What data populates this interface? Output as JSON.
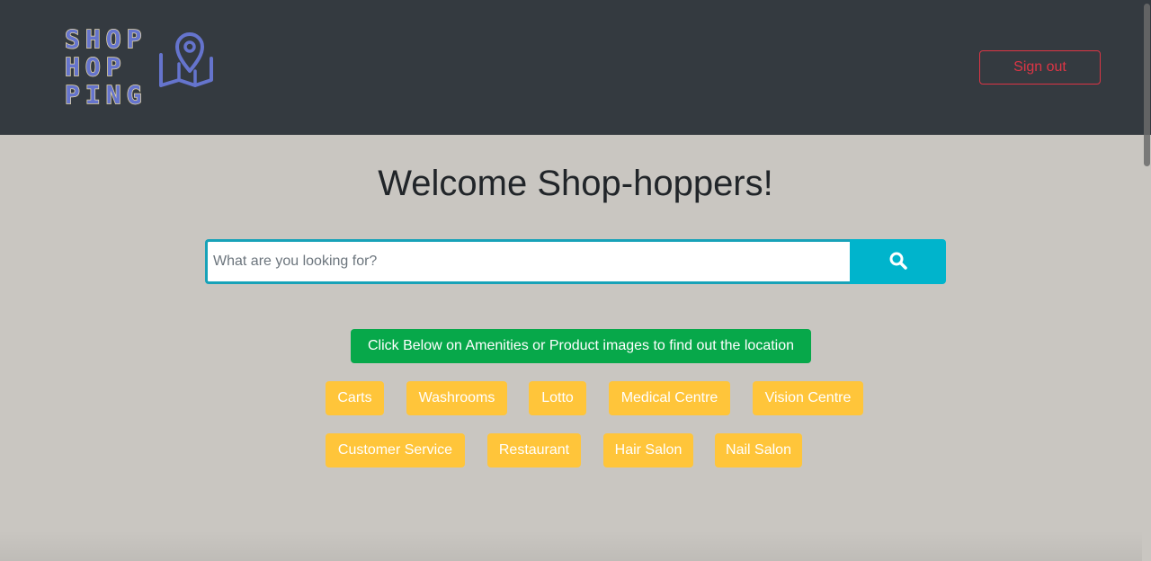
{
  "header": {
    "logo_lines": [
      "SHOP",
      "HOP",
      "PING"
    ],
    "logo_icon": "map-pin-icon",
    "signout_label": "Sign out"
  },
  "main": {
    "title": "Welcome Shop-hoppers!",
    "search": {
      "placeholder": "What are you looking for?",
      "value": "",
      "button_icon": "search-icon"
    },
    "info_label": "Click Below on Amenities or Product images to find out the location",
    "amenities": [
      "Carts",
      "Washrooms",
      "Lotto",
      "Medical Centre",
      "Vision Centre",
      "Customer Service",
      "Restaurant",
      "Hair Salon",
      "Nail Salon"
    ]
  },
  "colors": {
    "navbar": "#343a40",
    "background": "#c9c6c1",
    "logo": "#6574cd",
    "signout": "#dc3545",
    "search_border": "#17a2b8",
    "search_button": "#00b4cc",
    "info_button": "#07a84a",
    "amenity_button": "#ffc53a"
  }
}
